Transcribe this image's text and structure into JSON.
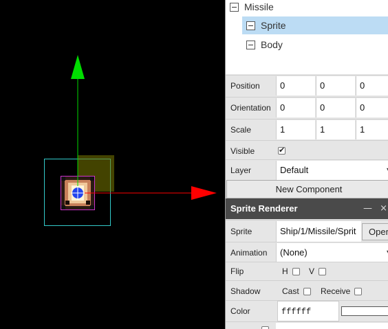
{
  "hierarchy": {
    "items": [
      {
        "label": "Missile",
        "selected": false
      },
      {
        "label": "Sprite",
        "selected": true
      },
      {
        "label": "Body",
        "selected": false
      }
    ]
  },
  "transform": {
    "position": {
      "label": "Position",
      "values": [
        "0",
        "0",
        "0"
      ]
    },
    "orientation": {
      "label": "Orientation",
      "values": [
        "0",
        "0",
        "0"
      ]
    },
    "scale": {
      "label": "Scale",
      "values": [
        "1",
        "1",
        "1"
      ]
    },
    "visible": {
      "label": "Visible",
      "checked": true
    },
    "layer": {
      "label": "Layer",
      "value": "Default"
    }
  },
  "new_component_label": "New Component",
  "sprite_renderer": {
    "title": "Sprite Renderer",
    "minimize_glyph": "—",
    "close_glyph": "×",
    "sprite": {
      "label": "Sprite",
      "value": "Ship/1/Missile/Sprit",
      "open_label": "Oper"
    },
    "animation": {
      "label": "Animation",
      "value": "(None)"
    },
    "flip": {
      "label": "Flip",
      "h_label": "H",
      "v_label": "V",
      "h": false,
      "v": false
    },
    "shadow": {
      "label": "Shadow",
      "cast_label": "Cast",
      "receive_label": "Receive",
      "cast": false,
      "receive": false
    },
    "color": {
      "label": "Color",
      "value": "ffffff",
      "swatch": "#ffffff"
    }
  },
  "colors": {
    "gizmo_y": "#00dd00",
    "gizmo_x": "#ff0000",
    "selection_box": "#33cccc",
    "selected_row": "#bcdcf4",
    "header_bg": "#4a4a4a"
  }
}
